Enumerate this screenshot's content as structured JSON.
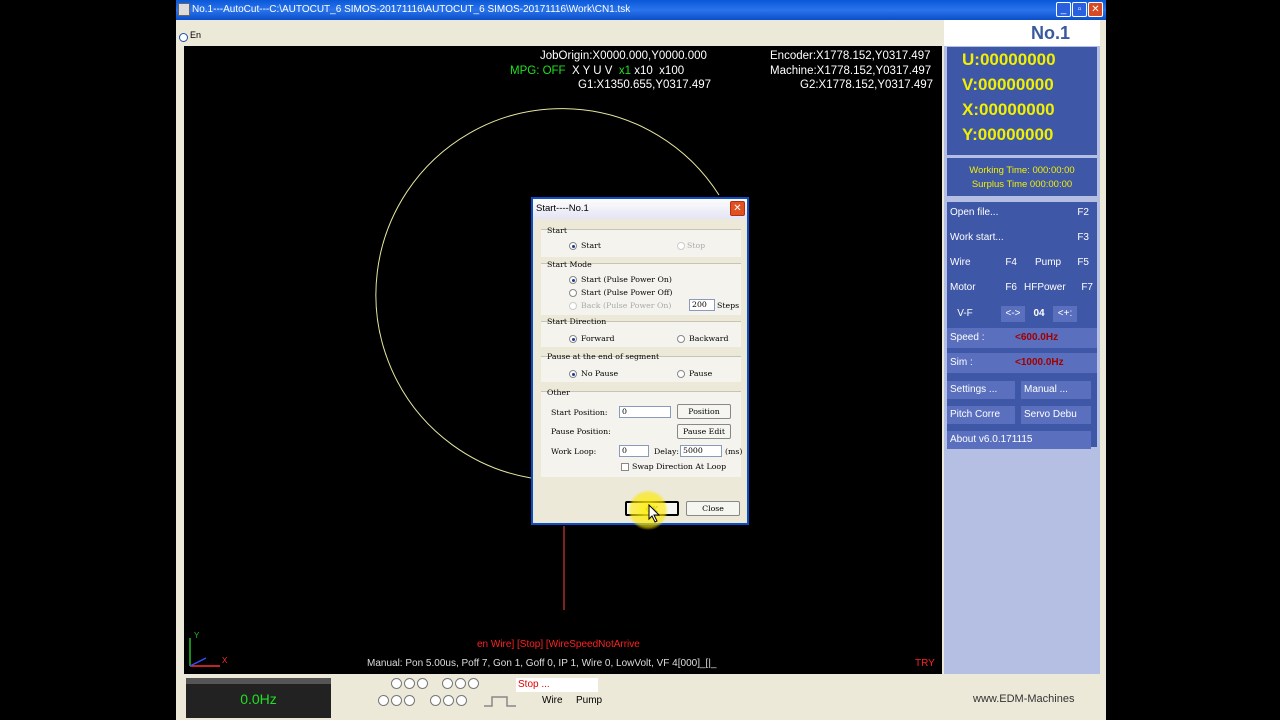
{
  "window": {
    "title": "No.1---AutoCut---C:\\AUTOCUT_6 SIMOS-20171116\\AUTOCUT_6 SIMOS-20171116\\Work\\CN1.tsk",
    "lang": "En"
  },
  "canvas": {
    "job_origin": "JobOrigin:X0000.000,Y0000.000",
    "encoder": "Encoder:X1778.152,Y0317.497",
    "mpg": "MPG: OFF",
    "axes": "X  Y  U  V",
    "mult_x1": "x1",
    "mult_x10": "x10",
    "mult_x100": "x100",
    "machine": "Machine:X1778.152,Y0317.497",
    "g1": "G1:X1350.655,Y0317.497",
    "g2": "G2:X1778.152,Y0317.497",
    "status_line": "en Wire]  [Stop]  [WireSpeedNotArrive",
    "manual_line": "Manual: Pon 5.00us, Poff 7, Gon 1, Goff 0, IP 1, Wire 0, LowVolt, VF 4[000]_[|_",
    "try_label": "TRY",
    "axis_y": "Y",
    "axis_x": "X"
  },
  "panel": {
    "title": "No.1",
    "u": "U:00000000",
    "v": "V:00000000",
    "x": "X:00000000",
    "y": "Y:00000000",
    "working_time": "Working Time: 000:00:00",
    "surplus_time": "Surplus Time 000:00:00",
    "open_file": "Open file...",
    "open_file_key": "F2",
    "work_start": "Work start...",
    "work_start_key": "F3",
    "wire": "Wire",
    "wire_key": "F4",
    "pump": "Pump",
    "pump_key": "F5",
    "motor": "Motor",
    "motor_key": "F6",
    "hfpower": "HFPower",
    "hfpower_key": "F7",
    "vf": "V-F",
    "vf_dec": "<->",
    "vf_value": "04",
    "vf_inc": "<+:",
    "speed_label": "Speed :",
    "speed_value": "<600.0Hz",
    "sim_label": "Sim    :",
    "sim_value": "<1000.0Hz",
    "settings": "Settings ...",
    "manual": "Manual ...",
    "pitch": "Pitch Corre",
    "servo": "Servo Debu",
    "about": "About v6.0.171115"
  },
  "bottom": {
    "hz": "0.0Hz",
    "stop": "Stop ...",
    "wire": "Wire",
    "pump": "Pump",
    "brand": "www.EDM-Machines"
  },
  "dialog": {
    "title": "Start----No.1",
    "grp_start": "Start",
    "start": "Start",
    "stop": "Stop",
    "grp_mode": "Start Mode",
    "mode_on": "Start  (Pulse Power On)",
    "mode_off": "Start  (Pulse Power Off)",
    "mode_back": "Back    (Pulse Power On)",
    "steps_value": "200",
    "steps_label": "Steps",
    "grp_dir": "Start Direction",
    "forward": "Forward",
    "backward": "Backward",
    "grp_pause": "Pause at the end of segment",
    "no_pause": "No Pause",
    "pause": "Pause",
    "grp_other": "Other",
    "start_pos_label": "Start Position:",
    "start_pos_value": "0",
    "position_btn": "Position",
    "pause_pos_label": "Pause Position:",
    "pause_edit_btn": "Pause Edit",
    "work_loop_label": "Work Loop:",
    "work_loop_value": "0",
    "delay_label": "Delay:",
    "delay_value": "5000",
    "ms_label": "(ms)",
    "swap_label": "Swap Direction At Loop",
    "ok": "OK",
    "close": "Close"
  }
}
